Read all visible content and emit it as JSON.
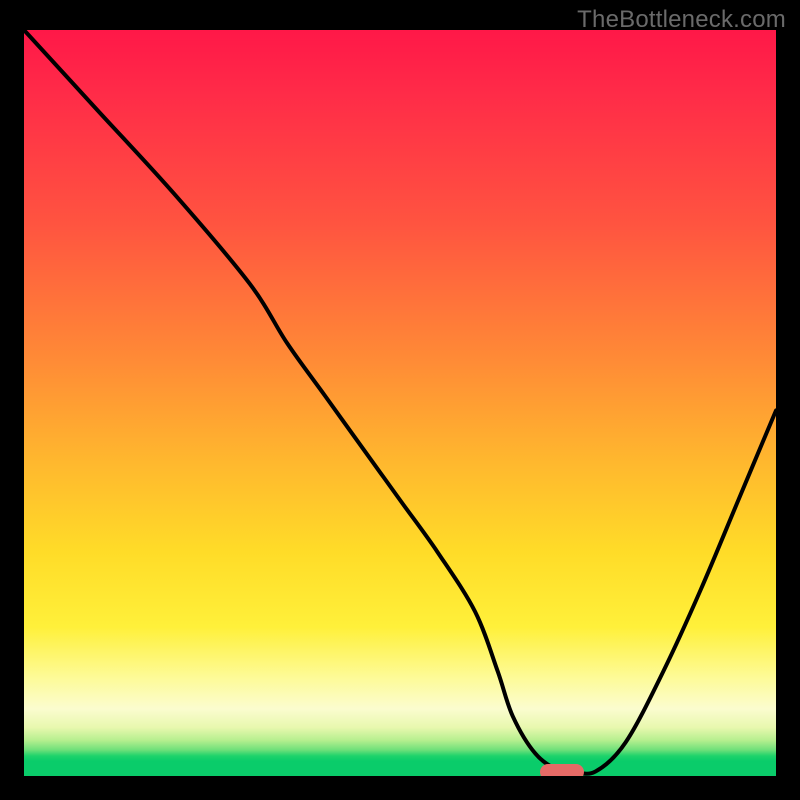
{
  "watermark": "TheBottleneck.com",
  "colors": {
    "curve": "#000000",
    "marker": "#e66a66"
  },
  "chart_data": {
    "type": "line",
    "title": "",
    "xlabel": "",
    "ylabel": "",
    "xlim": [
      0,
      100
    ],
    "ylim": [
      0,
      100
    ],
    "x": [
      0,
      10,
      20,
      30,
      35,
      40,
      45,
      50,
      55,
      60,
      63,
      65,
      68,
      71,
      73,
      76,
      80,
      85,
      90,
      95,
      100
    ],
    "y": [
      100,
      89,
      78,
      66,
      58,
      51,
      44,
      37,
      30,
      22,
      14,
      8,
      3,
      0.8,
      0.6,
      0.6,
      4.5,
      14,
      25,
      37,
      49
    ],
    "marker": {
      "x": 71.5,
      "y": 0.0
    },
    "series": [
      {
        "name": "bottleneck-curve",
        "x_key": "x",
        "y_key": "y"
      }
    ]
  }
}
